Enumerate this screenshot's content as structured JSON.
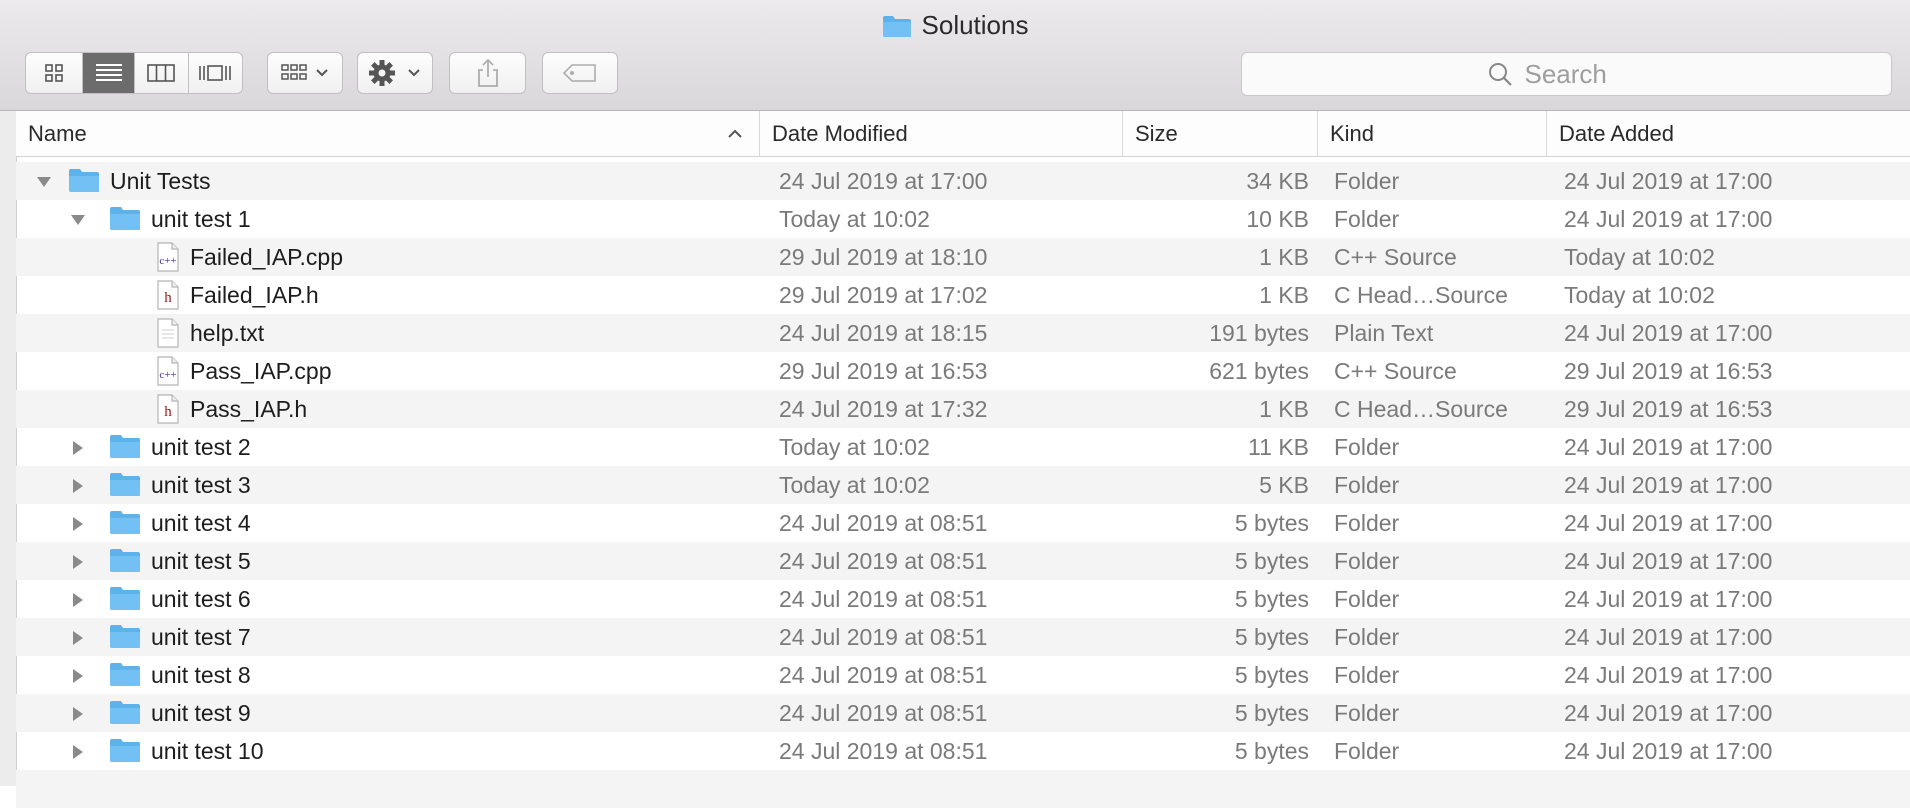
{
  "window": {
    "title": "Solutions"
  },
  "toolbar": {
    "view_modes": [
      "icon-view",
      "list-view",
      "column-view",
      "gallery-view"
    ],
    "active_view": "list-view",
    "group_button": "group-by",
    "action_button": "action-gear",
    "share_button": "share",
    "tags_button": "tags"
  },
  "search": {
    "placeholder": "Search",
    "value": ""
  },
  "columns": {
    "name": "Name",
    "date_modified": "Date Modified",
    "size": "Size",
    "kind": "Kind",
    "date_added": "Date Added",
    "sorted_by": "name",
    "sort_direction": "ascending"
  },
  "rows": [
    {
      "name": "Unit Tests",
      "level": 0,
      "disclosure": "open",
      "icon": "folder-icon",
      "date_modified": "24 Jul 2019 at 17:00",
      "size": "34 KB",
      "kind": "Folder",
      "date_added": "24 Jul 2019 at 17:00"
    },
    {
      "name": "unit test 1",
      "level": 1,
      "disclosure": "open",
      "icon": "folder-icon",
      "date_modified": "Today at 10:02",
      "size": "10 KB",
      "kind": "Folder",
      "date_added": "24 Jul 2019 at 17:00"
    },
    {
      "name": "Failed_IAP.cpp",
      "level": 2,
      "disclosure": "none",
      "icon": "cpp-file-icon",
      "date_modified": "29 Jul 2019 at 18:10",
      "size": "1 KB",
      "kind": "C++ Source",
      "date_added": "Today at 10:02"
    },
    {
      "name": "Failed_IAP.h",
      "level": 2,
      "disclosure": "none",
      "icon": "h-file-icon",
      "date_modified": "29 Jul 2019 at 17:02",
      "size": "1 KB",
      "kind": "C Head…Source",
      "date_added": "Today at 10:02"
    },
    {
      "name": "help.txt",
      "level": 2,
      "disclosure": "none",
      "icon": "text-file-icon",
      "date_modified": "24 Jul 2019 at 18:15",
      "size": "191 bytes",
      "kind": "Plain Text",
      "date_added": "24 Jul 2019 at 17:00"
    },
    {
      "name": "Pass_IAP.cpp",
      "level": 2,
      "disclosure": "none",
      "icon": "cpp-file-icon",
      "date_modified": "29 Jul 2019 at 16:53",
      "size": "621 bytes",
      "kind": "C++ Source",
      "date_added": "29 Jul 2019 at 16:53"
    },
    {
      "name": "Pass_IAP.h",
      "level": 2,
      "disclosure": "none",
      "icon": "h-file-icon",
      "date_modified": "24 Jul 2019 at 17:32",
      "size": "1 KB",
      "kind": "C Head…Source",
      "date_added": "29 Jul 2019 at 16:53"
    },
    {
      "name": "unit test 2",
      "level": 1,
      "disclosure": "closed",
      "icon": "folder-icon",
      "date_modified": "Today at 10:02",
      "size": "11 KB",
      "kind": "Folder",
      "date_added": "24 Jul 2019 at 17:00"
    },
    {
      "name": "unit test 3",
      "level": 1,
      "disclosure": "closed",
      "icon": "folder-icon",
      "date_modified": "Today at 10:02",
      "size": "5 KB",
      "kind": "Folder",
      "date_added": "24 Jul 2019 at 17:00"
    },
    {
      "name": "unit test 4",
      "level": 1,
      "disclosure": "closed",
      "icon": "folder-icon",
      "date_modified": "24 Jul 2019 at 08:51",
      "size": "5 bytes",
      "kind": "Folder",
      "date_added": "24 Jul 2019 at 17:00"
    },
    {
      "name": "unit test 5",
      "level": 1,
      "disclosure": "closed",
      "icon": "folder-icon",
      "date_modified": "24 Jul 2019 at 08:51",
      "size": "5 bytes",
      "kind": "Folder",
      "date_added": "24 Jul 2019 at 17:00"
    },
    {
      "name": "unit test 6",
      "level": 1,
      "disclosure": "closed",
      "icon": "folder-icon",
      "date_modified": "24 Jul 2019 at 08:51",
      "size": "5 bytes",
      "kind": "Folder",
      "date_added": "24 Jul 2019 at 17:00"
    },
    {
      "name": "unit test 7",
      "level": 1,
      "disclosure": "closed",
      "icon": "folder-icon",
      "date_modified": "24 Jul 2019 at 08:51",
      "size": "5 bytes",
      "kind": "Folder",
      "date_added": "24 Jul 2019 at 17:00"
    },
    {
      "name": "unit test 8",
      "level": 1,
      "disclosure": "closed",
      "icon": "folder-icon",
      "date_modified": "24 Jul 2019 at 08:51",
      "size": "5 bytes",
      "kind": "Folder",
      "date_added": "24 Jul 2019 at 17:00"
    },
    {
      "name": "unit test 9",
      "level": 1,
      "disclosure": "closed",
      "icon": "folder-icon",
      "date_modified": "24 Jul 2019 at 08:51",
      "size": "5 bytes",
      "kind": "Folder",
      "date_added": "24 Jul 2019 at 17:00"
    },
    {
      "name": "unit test 10",
      "level": 1,
      "disclosure": "closed",
      "icon": "folder-icon",
      "date_modified": "24 Jul 2019 at 08:51",
      "size": "5 bytes",
      "kind": "Folder",
      "date_added": "24 Jul 2019 at 17:00"
    }
  ],
  "colors": {
    "folder": "#73c0f4",
    "folder_tab": "#5eb2ea",
    "active_segment": "#6c6c6c",
    "row_stripe": "#f4f4f4",
    "secondary_text": "#7a7a7a"
  }
}
